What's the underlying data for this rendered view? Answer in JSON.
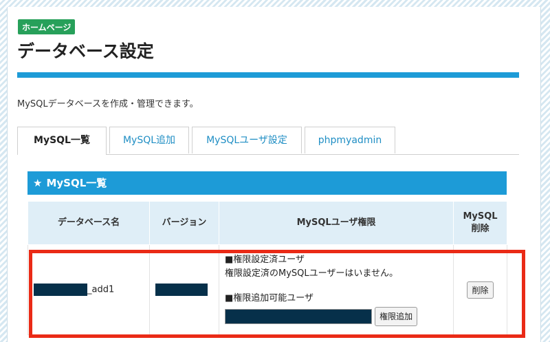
{
  "breadcrumb_badge": "ホームページ",
  "page_title": "データベース設定",
  "description": "MySQLデータベースを作成・管理できます。",
  "tabs": [
    {
      "label": "MySQL一覧",
      "active": true
    },
    {
      "label": "MySQL追加",
      "active": false
    },
    {
      "label": "MySQLユーザ設定",
      "active": false
    },
    {
      "label": "phpmyadmin",
      "active": false
    }
  ],
  "section": {
    "icon": "star-icon",
    "title": "MySQL一覧"
  },
  "table": {
    "headers": {
      "db_name": "データベース名",
      "version": "バージョン",
      "user_perm": "MySQLユーザ権限",
      "delete_line1": "MySQL",
      "delete_line2": "削除"
    },
    "rows": [
      {
        "db_name_suffix": "_add1",
        "perm_set_heading": "■権限設定済ユーザ",
        "perm_set_text": "権限設定済のMySQLユーザーはいません。",
        "perm_add_heading": "■権限追加可能ユーザ",
        "perm_add_button": "権限追加",
        "delete_button": "削除"
      }
    ]
  },
  "colors": {
    "accent": "#1d9bd7",
    "badge": "#27a05a",
    "highlight": "#ea2a16",
    "redaction": "#06304a"
  }
}
